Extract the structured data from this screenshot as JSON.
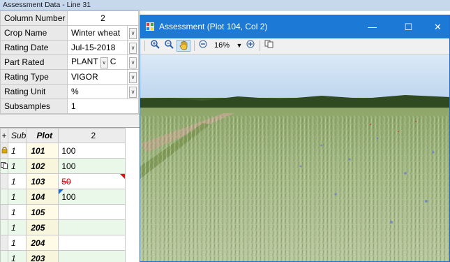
{
  "app": {
    "title": "Assessment Data - Line 31"
  },
  "properties": [
    {
      "label": "Column Number",
      "value": "2",
      "centered": true,
      "dropdown": false
    },
    {
      "label": "Crop Name",
      "value": "Winter wheat",
      "dropdown": true
    },
    {
      "label": "Rating Date",
      "value": "Jul-15-2018",
      "dropdown": true
    },
    {
      "label": "Part Rated",
      "value": "PLANT",
      "value2": "C",
      "dropdown": true
    },
    {
      "label": "Rating Type",
      "value": "VIGOR",
      "dropdown": true
    },
    {
      "label": "Rating Unit",
      "value": "%",
      "dropdown": true
    },
    {
      "label": "Subsamples",
      "value": "1",
      "dropdown": false
    }
  ],
  "grid": {
    "headers": {
      "expander": "+",
      "sub": "Sub",
      "plot": "Plot",
      "column": "2"
    },
    "rows": [
      {
        "icon": "lock-icon",
        "sub": "1",
        "plot": "101",
        "value": "100"
      },
      {
        "icon": "copy-icon",
        "sub": "1",
        "plot": "102",
        "value": "100"
      },
      {
        "icon": "",
        "sub": "1",
        "plot": "103",
        "value": "50",
        "strike": true,
        "flag": "red"
      },
      {
        "icon": "",
        "sub": "1",
        "plot": "104",
        "value": "100",
        "flag": "blue"
      },
      {
        "icon": "",
        "sub": "1",
        "plot": "105",
        "value": ""
      },
      {
        "icon": "",
        "sub": "1",
        "plot": "205",
        "value": ""
      },
      {
        "icon": "",
        "sub": "1",
        "plot": "204",
        "value": ""
      },
      {
        "icon": "",
        "sub": "1",
        "plot": "203",
        "value": ""
      }
    ]
  },
  "viewer": {
    "title": "Assessment (Plot 104, Col  2)",
    "zoom": "16%",
    "icons": [
      "zoom-in-icon",
      "zoom-out-icon",
      "pan-hand-icon",
      "zoom-minus-icon",
      "zoom-dropdown-icon",
      "zoom-plus-icon",
      "copy-image-icon"
    ],
    "controls": {
      "minimize": "—",
      "maximize": "☐",
      "close": "✕"
    }
  },
  "colors": {
    "accent": "#1c79d6",
    "grid_alt": "#e9f8e9",
    "strike": "#c00000"
  }
}
